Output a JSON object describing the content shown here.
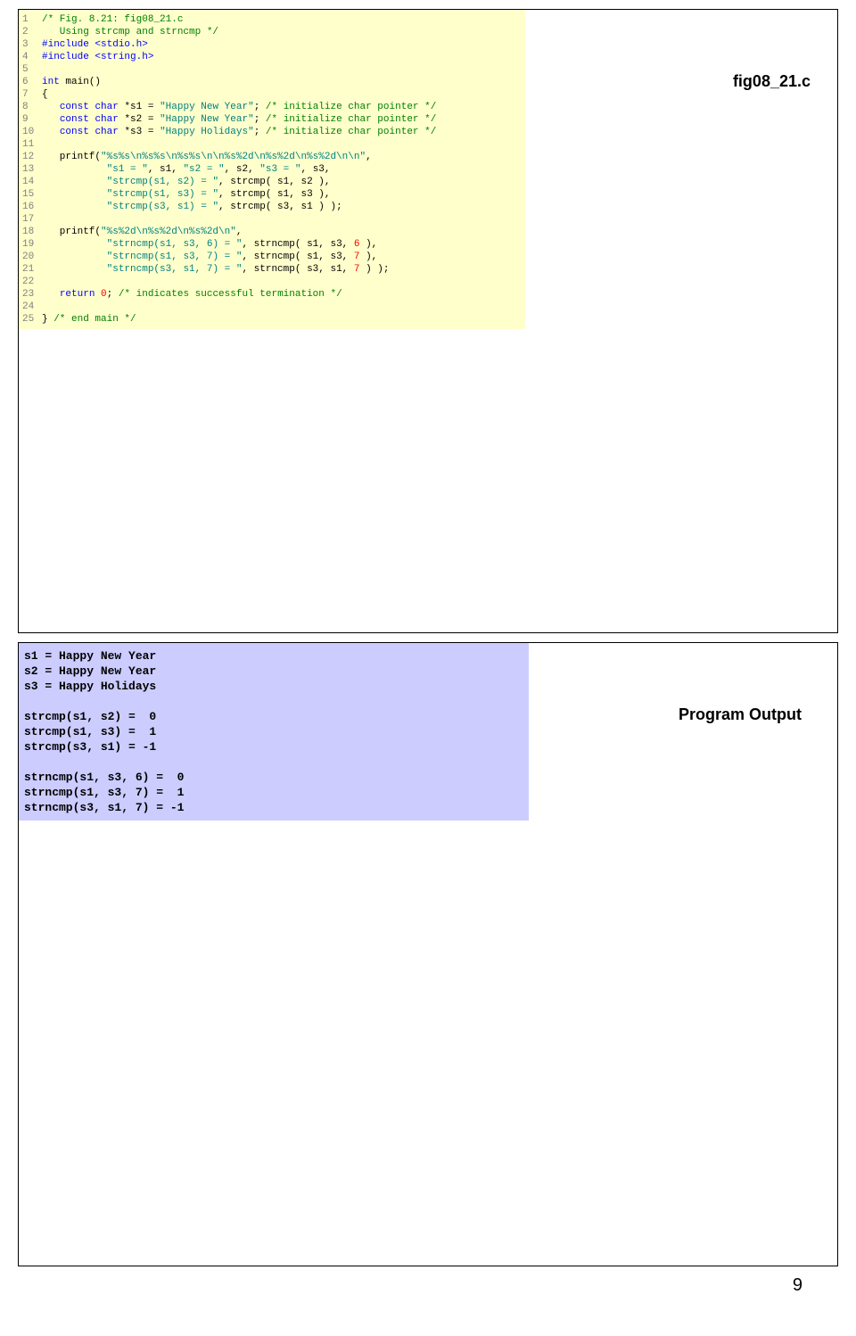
{
  "slide1": {
    "label": "fig08_21.c",
    "lines": [
      {
        "n": "1",
        "segs": [
          {
            "t": "/* Fig. 8.21: fig08_21.c",
            "c": "c-comment"
          }
        ]
      },
      {
        "n": "2",
        "segs": [
          {
            "t": "   Using strcmp and strncmp */",
            "c": "c-comment"
          }
        ]
      },
      {
        "n": "3",
        "segs": [
          {
            "t": "#include ",
            "c": "c-pre"
          },
          {
            "t": "<stdio.h>",
            "c": "c-pre"
          }
        ]
      },
      {
        "n": "4",
        "segs": [
          {
            "t": "#include ",
            "c": "c-pre"
          },
          {
            "t": "<string.h>",
            "c": "c-pre"
          }
        ]
      },
      {
        "n": "5",
        "segs": [
          {
            "t": "",
            "c": ""
          }
        ]
      },
      {
        "n": "6",
        "segs": [
          {
            "t": "int",
            "c": "c-kw"
          },
          {
            "t": " main()",
            "c": ""
          }
        ]
      },
      {
        "n": "7",
        "segs": [
          {
            "t": "{",
            "c": ""
          }
        ]
      },
      {
        "n": "8",
        "segs": [
          {
            "t": "   ",
            "c": ""
          },
          {
            "t": "const",
            "c": "c-kw"
          },
          {
            "t": " ",
            "c": ""
          },
          {
            "t": "char",
            "c": "c-kw"
          },
          {
            "t": " *s1 = ",
            "c": ""
          },
          {
            "t": "\"Happy New Year\"",
            "c": "c-str"
          },
          {
            "t": "; ",
            "c": ""
          },
          {
            "t": "/* initialize char pointer */",
            "c": "c-comment"
          }
        ]
      },
      {
        "n": "9",
        "segs": [
          {
            "t": "   ",
            "c": ""
          },
          {
            "t": "const",
            "c": "c-kw"
          },
          {
            "t": " ",
            "c": ""
          },
          {
            "t": "char",
            "c": "c-kw"
          },
          {
            "t": " *s2 = ",
            "c": ""
          },
          {
            "t": "\"Happy New Year\"",
            "c": "c-str"
          },
          {
            "t": "; ",
            "c": ""
          },
          {
            "t": "/* initialize char pointer */",
            "c": "c-comment"
          }
        ]
      },
      {
        "n": "10",
        "segs": [
          {
            "t": "   ",
            "c": ""
          },
          {
            "t": "const",
            "c": "c-kw"
          },
          {
            "t": " ",
            "c": ""
          },
          {
            "t": "char",
            "c": "c-kw"
          },
          {
            "t": " *s3 = ",
            "c": ""
          },
          {
            "t": "\"Happy Holidays\"",
            "c": "c-str"
          },
          {
            "t": "; ",
            "c": ""
          },
          {
            "t": "/* initialize char pointer */",
            "c": "c-comment"
          }
        ]
      },
      {
        "n": "11",
        "segs": [
          {
            "t": "",
            "c": ""
          }
        ]
      },
      {
        "n": "12",
        "segs": [
          {
            "t": "   printf(",
            "c": ""
          },
          {
            "t": "\"%s%s\\n%s%s\\n%s%s\\n\\n%s%2d\\n%s%2d\\n%s%2d\\n\\n\"",
            "c": "c-str"
          },
          {
            "t": ",",
            "c": ""
          }
        ]
      },
      {
        "n": "13",
        "segs": [
          {
            "t": "           ",
            "c": ""
          },
          {
            "t": "\"s1 = \"",
            "c": "c-str"
          },
          {
            "t": ", s1, ",
            "c": ""
          },
          {
            "t": "\"s2 = \"",
            "c": "c-str"
          },
          {
            "t": ", s2, ",
            "c": ""
          },
          {
            "t": "\"s3 = \"",
            "c": "c-str"
          },
          {
            "t": ", s3,",
            "c": ""
          }
        ]
      },
      {
        "n": "14",
        "segs": [
          {
            "t": "           ",
            "c": ""
          },
          {
            "t": "\"strcmp(s1, s2) = \"",
            "c": "c-str"
          },
          {
            "t": ", strcmp( s1, s2 ),",
            "c": ""
          }
        ]
      },
      {
        "n": "15",
        "segs": [
          {
            "t": "           ",
            "c": ""
          },
          {
            "t": "\"strcmp(s1, s3) = \"",
            "c": "c-str"
          },
          {
            "t": ", strcmp( s1, s3 ),",
            "c": ""
          }
        ]
      },
      {
        "n": "16",
        "segs": [
          {
            "t": "           ",
            "c": ""
          },
          {
            "t": "\"strcmp(s3, s1) = \"",
            "c": "c-str"
          },
          {
            "t": ", strcmp( s3, s1 ) );",
            "c": ""
          }
        ]
      },
      {
        "n": "17",
        "segs": [
          {
            "t": "",
            "c": ""
          }
        ]
      },
      {
        "n": "18",
        "segs": [
          {
            "t": "   printf(",
            "c": ""
          },
          {
            "t": "\"%s%2d\\n%s%2d\\n%s%2d\\n\"",
            "c": "c-str"
          },
          {
            "t": ",",
            "c": ""
          }
        ]
      },
      {
        "n": "19",
        "segs": [
          {
            "t": "           ",
            "c": ""
          },
          {
            "t": "\"strncmp(s1, s3, 6) = \"",
            "c": "c-str"
          },
          {
            "t": ", strncmp( s1, s3, ",
            "c": ""
          },
          {
            "t": "6",
            "c": "c-num"
          },
          {
            "t": " ),",
            "c": ""
          }
        ]
      },
      {
        "n": "20",
        "segs": [
          {
            "t": "           ",
            "c": ""
          },
          {
            "t": "\"strncmp(s1, s3, 7) = \"",
            "c": "c-str"
          },
          {
            "t": ", strncmp( s1, s3, ",
            "c": ""
          },
          {
            "t": "7",
            "c": "c-num"
          },
          {
            "t": " ),",
            "c": ""
          }
        ]
      },
      {
        "n": "21",
        "segs": [
          {
            "t": "           ",
            "c": ""
          },
          {
            "t": "\"strncmp(s3, s1, 7) = \"",
            "c": "c-str"
          },
          {
            "t": ", strncmp( s3, s1, ",
            "c": ""
          },
          {
            "t": "7",
            "c": "c-num"
          },
          {
            "t": " ) );",
            "c": ""
          }
        ]
      },
      {
        "n": "22",
        "segs": [
          {
            "t": "",
            "c": ""
          }
        ]
      },
      {
        "n": "23",
        "segs": [
          {
            "t": "   ",
            "c": ""
          },
          {
            "t": "return",
            "c": "c-kw"
          },
          {
            "t": " ",
            "c": ""
          },
          {
            "t": "0",
            "c": "c-num"
          },
          {
            "t": "; ",
            "c": ""
          },
          {
            "t": "/* indicates successful termination */",
            "c": "c-comment"
          }
        ]
      },
      {
        "n": "24",
        "segs": [
          {
            "t": "",
            "c": ""
          }
        ]
      },
      {
        "n": "25",
        "segs": [
          {
            "t": "} ",
            "c": ""
          },
          {
            "t": "/* end main */",
            "c": "c-comment"
          }
        ]
      }
    ]
  },
  "slide2": {
    "label": "Program Output",
    "output": "s1 = Happy New Year\ns2 = Happy New Year\ns3 = Happy Holidays\n\nstrcmp(s1, s2) =  0\nstrcmp(s1, s3) =  1\nstrcmp(s3, s1) = -1\n\nstrncmp(s1, s3, 6) =  0\nstrncmp(s1, s3, 7) =  1\nstrncmp(s3, s1, 7) = -1"
  },
  "pagenum": "9"
}
